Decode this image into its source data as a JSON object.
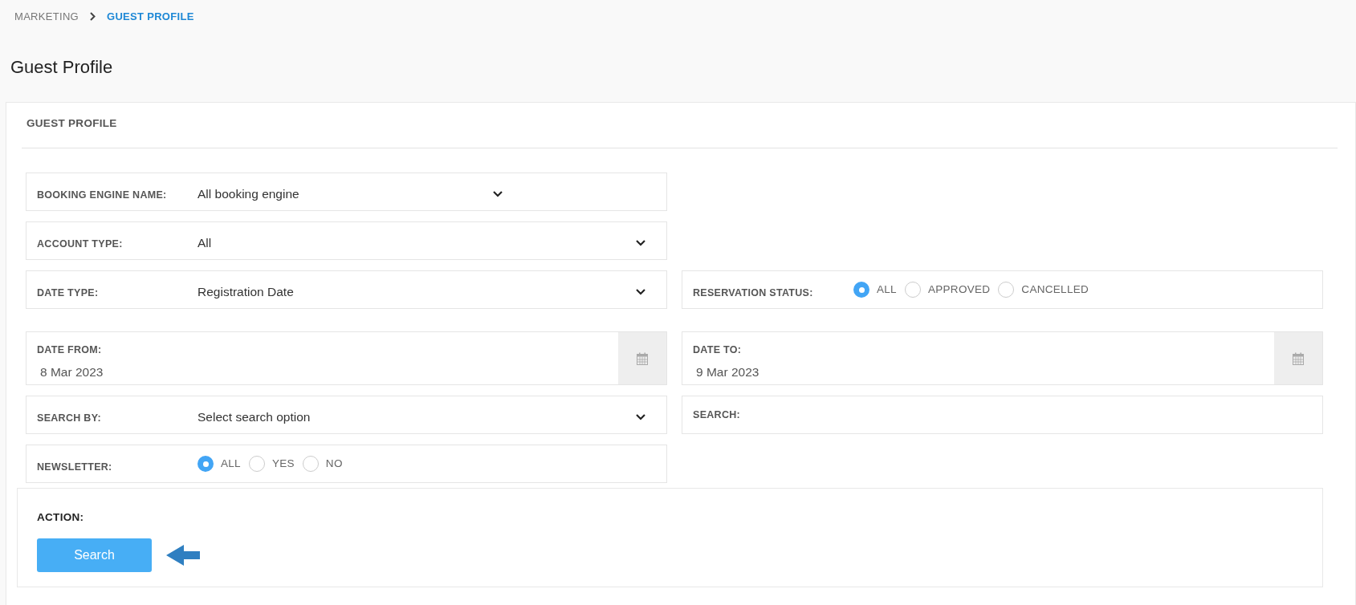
{
  "breadcrumb": [
    {
      "label": "MARKETING",
      "selected": false
    },
    {
      "label": "GUEST PROFILE",
      "selected": true
    }
  ],
  "page_title": "Guest Profile",
  "card": {
    "title": "GUEST PROFILE",
    "rows": [
      [
        {
          "kind": "select",
          "label": "BOOKING ENGINE NAME:",
          "value": "All booking engine"
        }
      ],
      [
        {
          "kind": "select",
          "label": "ACCOUNT TYPE:",
          "value": "All"
        }
      ],
      [
        {
          "kind": "select",
          "label": "DATE TYPE:",
          "value": "Registration Date"
        },
        {
          "kind": "radio",
          "label": "RESERVATION STATUS:",
          "options": [
            {
              "label": "ALL",
              "selected": true
            },
            {
              "label": "APPROVED",
              "selected": false
            },
            {
              "label": "CANCELLED",
              "selected": false
            }
          ]
        }
      ],
      [
        {
          "kind": "date",
          "label": "DATE FROM:",
          "value": "8 Mar 2023"
        },
        {
          "kind": "date",
          "label": "DATE TO:",
          "value": "9 Mar 2023"
        }
      ],
      [
        {
          "kind": "select",
          "label": "SEARCH BY:",
          "value": "Select search option"
        },
        {
          "kind": "text",
          "label": "SEARCH:"
        }
      ],
      [
        {
          "kind": "radio",
          "label": "NEWSLETTER:",
          "options": [
            {
              "label": "ALL",
              "selected": true
            },
            {
              "label": "YES",
              "selected": false
            },
            {
              "label": "NO",
              "selected": false
            }
          ]
        }
      ]
    ],
    "action": {
      "label": "ACTION:",
      "button": "Search"
    }
  }
}
